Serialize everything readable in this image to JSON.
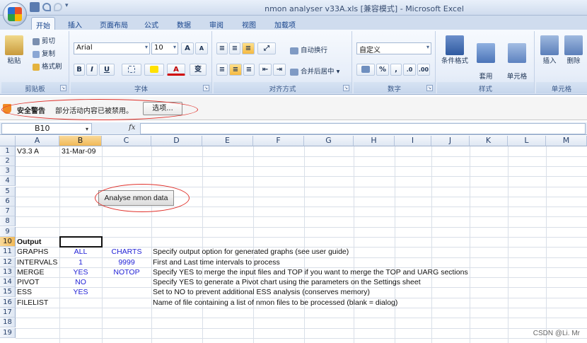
{
  "window": {
    "title": "nmon analyser v33A.xls  [兼容模式] - Microsoft Excel"
  },
  "ribbon_tabs": [
    "开始",
    "插入",
    "页面布局",
    "公式",
    "数据",
    "审阅",
    "视图",
    "加载项"
  ],
  "clipboard": {
    "paste": "粘贴",
    "cut": "剪切",
    "copy": "复制",
    "format_painter": "格式刷",
    "group_label": "剪贴板"
  },
  "font": {
    "name": "Arial",
    "size": "10",
    "grow": "A",
    "shrink": "A",
    "bold": "B",
    "italic": "I",
    "underline": "U",
    "font_color": "A",
    "phonetic": "变",
    "group_label": "字体"
  },
  "alignment": {
    "wrap_text": "自动换行",
    "merge_center": "合并后居中",
    "group_label": "对齐方式"
  },
  "number": {
    "format": "自定义",
    "percent": "%",
    "comma": ",",
    "group_label": "数字"
  },
  "styles": {
    "conditional": "条件格式",
    "table": "套用\n表格格式",
    "cell_styles": "单元格\n样式",
    "group_label": "样式"
  },
  "cells": {
    "insert": "插入",
    "delete": "删除",
    "group_label": "单元格"
  },
  "security": {
    "title": "安全警告",
    "message": "部分活动内容已被禁用。",
    "options_button": "选项..."
  },
  "formula_bar": {
    "name_box": "B10",
    "fx": "fx",
    "value": ""
  },
  "columns": [
    "A",
    "B",
    "C",
    "D",
    "E",
    "F",
    "G",
    "H",
    "I",
    "J",
    "K",
    "L",
    "M"
  ],
  "rows": [
    "1",
    "2",
    "3",
    "4",
    "5",
    "6",
    "7",
    "8",
    "9",
    "10",
    "11",
    "12",
    "13",
    "14",
    "15",
    "16",
    "17",
    "18",
    "19"
  ],
  "sheet_button": "Analyse nmon data",
  "sheet": {
    "r1": {
      "a": "V3.3 A",
      "b": "31-Mar-09"
    },
    "r10": {
      "a": "Output"
    },
    "r11": {
      "a": "GRAPHS",
      "b": "ALL",
      "c": "CHARTS",
      "d": "Specify output option for generated graphs (see user guide)"
    },
    "r12": {
      "a": "INTERVALS",
      "b": "1",
      "c": "9999",
      "d": "First and Last time intervals to process"
    },
    "r13": {
      "a": "MERGE",
      "b": "YES",
      "c": "NOTOP",
      "d": "Specify YES to merge the input files and TOP if you want to merge the TOP and UARG sections"
    },
    "r14": {
      "a": "PIVOT",
      "b": "NO",
      "d": "Specify YES to generate a Pivot chart using the parameters on the Settings sheet"
    },
    "r15": {
      "a": "ESS",
      "b": "YES",
      "d": "Set to NO to prevent additional ESS analysis (conserves memory)"
    },
    "r16": {
      "a": "FILELIST",
      "d": "Name of file containing a list of nmon files to be processed (blank = dialog)"
    }
  },
  "watermark": "CSDN @Li. Mr"
}
